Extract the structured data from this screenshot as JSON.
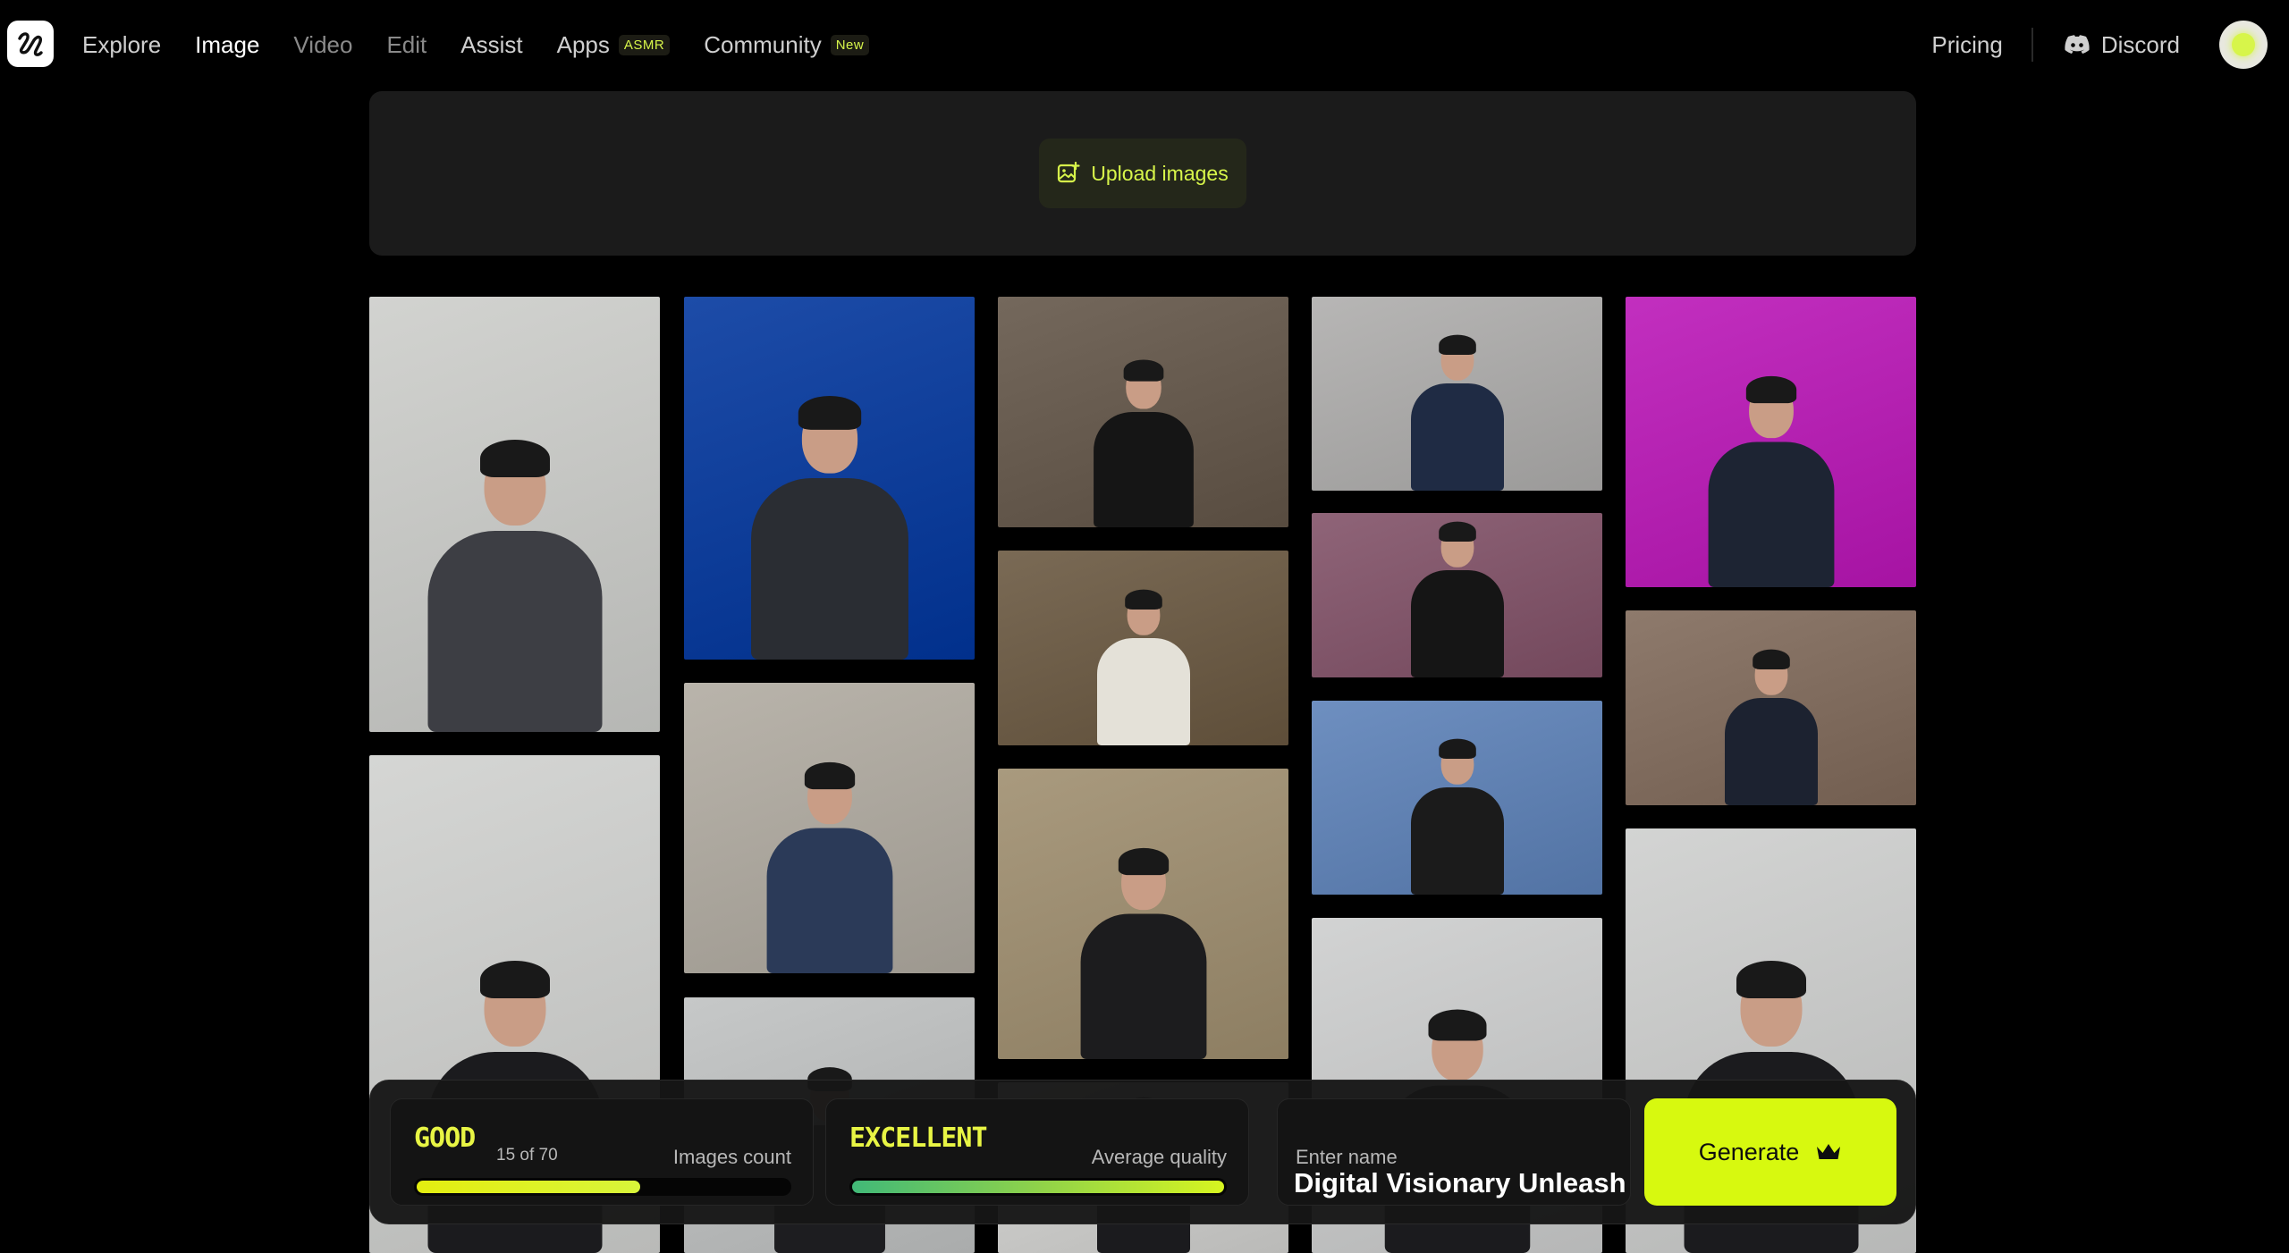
{
  "nav": {
    "items": [
      {
        "label": "Explore",
        "state": "normal"
      },
      {
        "label": "Image",
        "state": "active"
      },
      {
        "label": "Video",
        "state": "dim"
      },
      {
        "label": "Edit",
        "state": "dim"
      },
      {
        "label": "Assist",
        "state": "normal"
      },
      {
        "label": "Apps",
        "tag": "ASMR",
        "state": "normal"
      },
      {
        "label": "Community",
        "tag": "New",
        "state": "normal"
      }
    ],
    "pricing": "Pricing",
    "discord": "Discord"
  },
  "upload": {
    "label": "Upload images"
  },
  "gallery": {
    "tiles": [
      {
        "bg": "#d2d3d0",
        "shirt": "#3d3e44"
      },
      {
        "bg": "#d5d6d4",
        "shirt": "#1b1b1e"
      },
      {
        "bg": "#1d4ca8",
        "shirt": "#2a2d33"
      },
      {
        "bg": "#b9b4ab",
        "shirt": "#2b3a58"
      },
      {
        "bg": "#c6c8c8",
        "shirt": "#1d1d20"
      },
      {
        "bg": "#74685c",
        "shirt": "#151515"
      },
      {
        "bg": "#7a6a55",
        "shirt": "#e4e1d8"
      },
      {
        "bg": "#a99a7e",
        "shirt": "#1c1c1e"
      },
      {
        "bg": "#d6d6d4",
        "shirt": "#1b1b1e"
      },
      {
        "bg": "#b7b6b5",
        "shirt": "#1f2b44"
      },
      {
        "bg": "#8f6478",
        "shirt": "#151515"
      },
      {
        "bg": "#6e8fc0",
        "shirt": "#1b1b1b"
      },
      {
        "bg": "#d2d3d3",
        "shirt": "#1b1b1e"
      },
      {
        "bg": "#c22fbf",
        "shirt": "#1d2433"
      },
      {
        "bg": "#8e7a6c",
        "shirt": "#1c2230"
      },
      {
        "bg": "#d3d4d3",
        "shirt": "#1b1b1e"
      }
    ]
  },
  "controls": {
    "quantity": {
      "level": "GOOD",
      "count": "15 of 70",
      "label": "Images count",
      "progress": 0.6
    },
    "quality": {
      "level": "EXCELLENT",
      "label": "Average quality",
      "progress": 1.0
    },
    "name": {
      "label": "Enter name",
      "value": "Digital Visionary Unleashed"
    },
    "generate": "Generate"
  },
  "colors": {
    "accent": "#d7f90f",
    "badge": "#e8f544"
  }
}
